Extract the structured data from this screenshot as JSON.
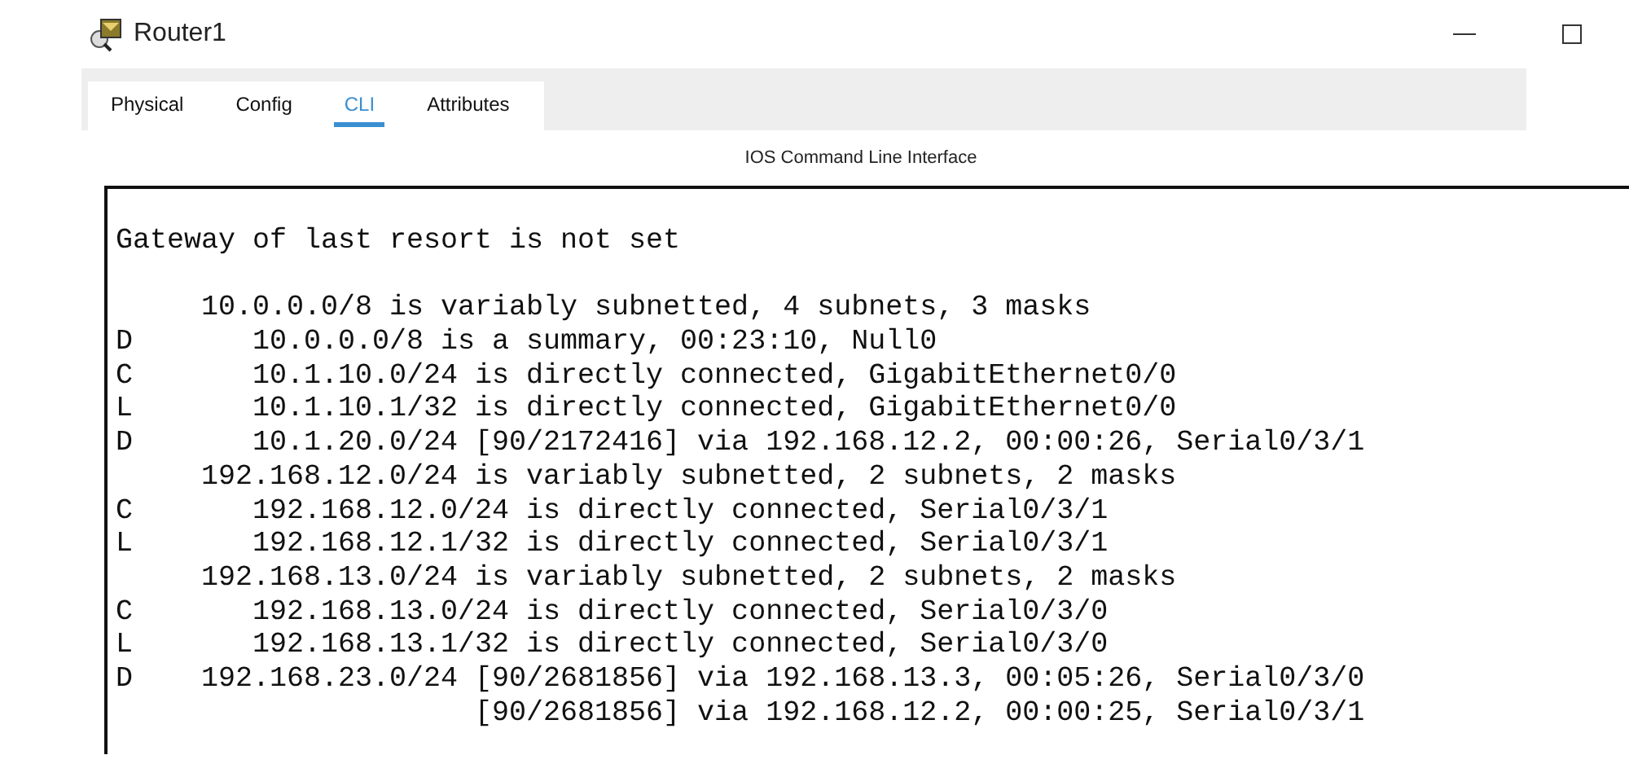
{
  "window": {
    "title": "Router1"
  },
  "tabs": [
    {
      "label": "Physical",
      "selected": false
    },
    {
      "label": "Config",
      "selected": false
    },
    {
      "label": "CLI",
      "selected": true
    },
    {
      "label": "Attributes",
      "selected": false
    }
  ],
  "panel_title": "IOS Command Line Interface",
  "gateway_line": "Gateway of last resort is not set",
  "terminal_lines": [
    "     10.0.0.0/8 is variably subnetted, 4 subnets, 3 masks",
    "D       10.0.0.0/8 is a summary, 00:23:10, Null0",
    "C       10.1.10.0/24 is directly connected, GigabitEthernet0/0",
    "L       10.1.10.1/32 is directly connected, GigabitEthernet0/0",
    "D       10.1.20.0/24 [90/2172416] via 192.168.12.2, 00:00:26, Serial0/3/1",
    "     192.168.12.0/24 is variably subnetted, 2 subnets, 2 masks",
    "C       192.168.12.0/24 is directly connected, Serial0/3/1",
    "L       192.168.12.1/32 is directly connected, Serial0/3/1",
    "     192.168.13.0/24 is variably subnetted, 2 subnets, 2 masks",
    "C       192.168.13.0/24 is directly connected, Serial0/3/0",
    "L       192.168.13.1/32 is directly connected, Serial0/3/0",
    "D    192.168.23.0/24 [90/2681856] via 192.168.13.3, 00:05:26, Serial0/3/0",
    "                     [90/2681856] via 192.168.12.2, 00:00:25, Serial0/3/1"
  ]
}
